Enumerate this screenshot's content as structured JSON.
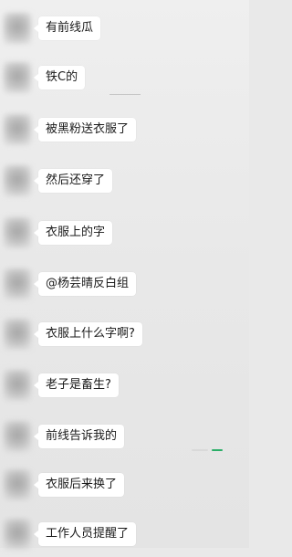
{
  "chat": {
    "messages": [
      {
        "text": "有前线瓜"
      },
      {
        "text": "铁C的"
      },
      {
        "text": "被黑粉送衣服了"
      },
      {
        "text": "然后还穿了"
      },
      {
        "text": "衣服上的字"
      },
      {
        "text": "@杨芸晴反白组"
      },
      {
        "text": "衣服上什么字啊?"
      },
      {
        "text": "老子是畜生?"
      },
      {
        "text": "前线告诉我的"
      },
      {
        "text": "衣服后来换了"
      },
      {
        "text": "工作人员提醒了"
      }
    ]
  },
  "colors": {
    "background": "#ebebeb",
    "bubble": "#ffffff",
    "text": "#1a1a1a",
    "accent_green": "#2aae67"
  }
}
